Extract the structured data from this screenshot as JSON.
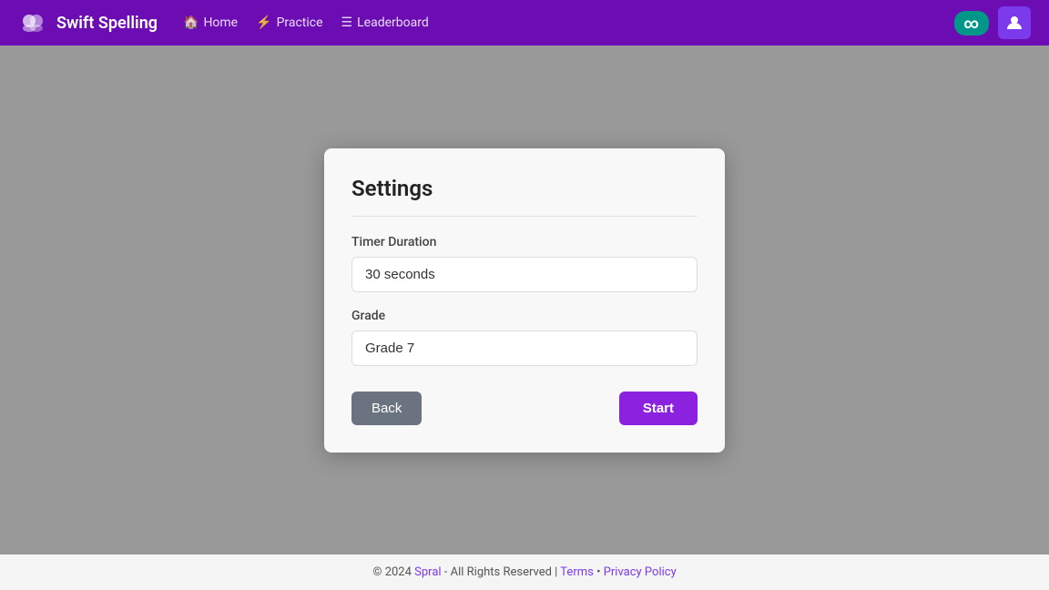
{
  "brand": {
    "name": "Swift Spelling"
  },
  "nav": {
    "links": [
      {
        "label": "Home",
        "icon": "🏠"
      },
      {
        "label": "Practice",
        "icon": "⚡"
      },
      {
        "label": "Leaderboard",
        "icon": "≡"
      }
    ],
    "infinity_label": "∞",
    "user_icon": "👤"
  },
  "modal": {
    "title": "Settings",
    "timer_duration_label": "Timer Duration",
    "timer_duration_value": "30 seconds",
    "grade_label": "Grade",
    "grade_value": "Grade 7",
    "back_button": "Back",
    "start_button": "Start"
  },
  "footer": {
    "copyright": "© 2024",
    "company_link": "Spral",
    "separator": "- All Rights Reserved |",
    "terms_link": "Terms",
    "bullet": "•",
    "privacy_link": "Privacy Policy"
  }
}
